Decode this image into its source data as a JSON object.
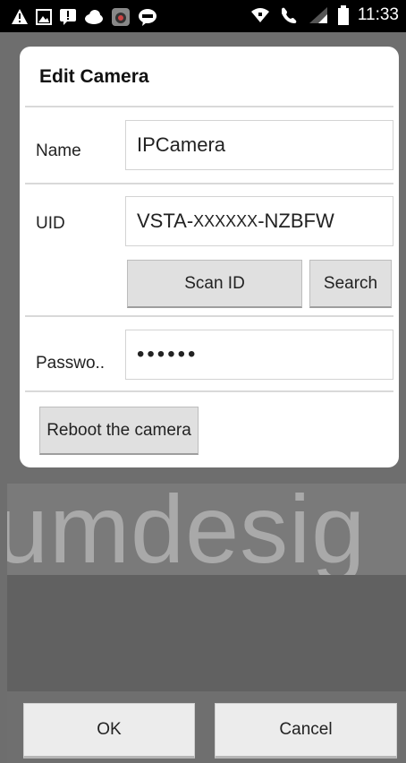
{
  "status_bar": {
    "time": "11:33",
    "left_icons": [
      "warning-icon",
      "image-icon",
      "alert-icon",
      "cloud-icon",
      "game-app-icon",
      "line-icon"
    ],
    "right_icons": [
      "wifi-icon",
      "call-icon",
      "signal-icon",
      "battery-icon"
    ]
  },
  "dialog": {
    "title": "Edit Camera",
    "name_label": "Name",
    "name_value": "IPCamera",
    "uid_label": "UID",
    "uid_value_prefix": "VSTA-",
    "uid_value_mask": "XXXXXX",
    "uid_value_suffix": "-NZBFW",
    "scan_id_label": "Scan ID",
    "search_label": "Search",
    "password_label": "Passwo..",
    "password_value": "••••••",
    "reboot_label": "Reboot the camera"
  },
  "watermark": {
    "text": "umdesig"
  },
  "footer": {
    "ok_label": "OK",
    "cancel_label": "Cancel"
  },
  "colors": {
    "backdrop": "#6e6e6e",
    "dialog_bg": "#ffffff",
    "button_bg": "#e0e0e0"
  }
}
